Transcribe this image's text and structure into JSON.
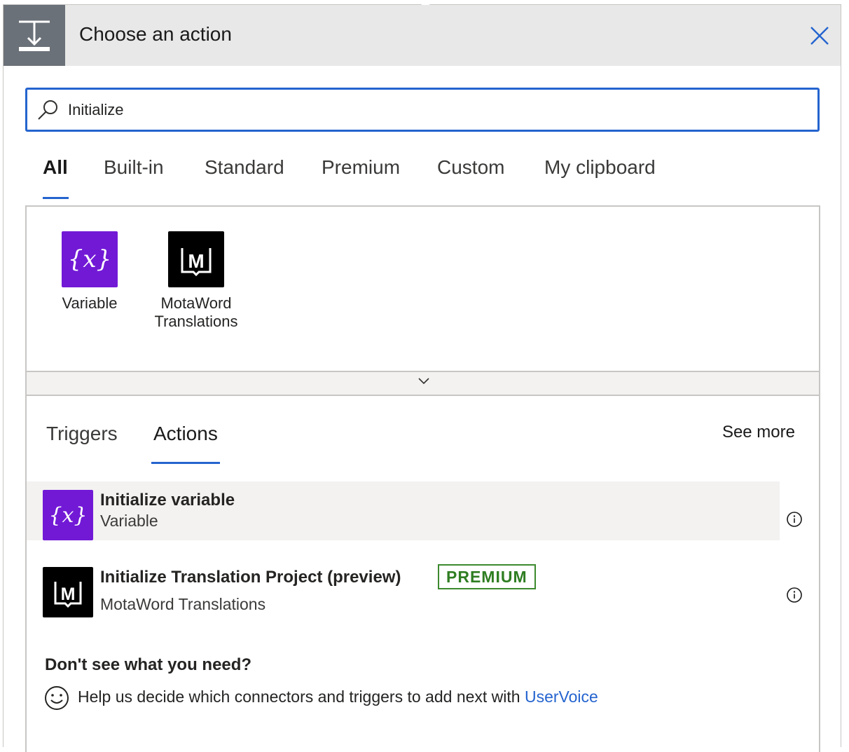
{
  "header": {
    "title": "Choose an action",
    "icon": "insert-step-icon",
    "close_icon": "close-icon"
  },
  "search": {
    "value": "Initialize",
    "icon": "search-icon"
  },
  "tabs": [
    {
      "label": "All",
      "active": true
    },
    {
      "label": "Built-in"
    },
    {
      "label": "Standard"
    },
    {
      "label": "Premium"
    },
    {
      "label": "Custom"
    },
    {
      "label": "My clipboard"
    }
  ],
  "connectors": [
    {
      "label": "Variable",
      "icon": "variable-icon",
      "color": "#7219d6"
    },
    {
      "label_line1": "MotaWord",
      "label_line2": "Translations",
      "icon": "motaword-icon",
      "color": "#000000"
    }
  ],
  "expand_icon": "chevron-down-icon",
  "sub_tabs": [
    {
      "label": "Triggers"
    },
    {
      "label": "Actions",
      "active": true
    }
  ],
  "see_more": "See more",
  "actions": [
    {
      "title": "Initialize variable",
      "subtitle": "Variable",
      "icon": "variable-icon",
      "info_icon": "info-icon"
    },
    {
      "title": "Initialize Translation Project (preview)",
      "subtitle": "MotaWord Translations",
      "badge": "PREMIUM",
      "icon": "motaword-icon",
      "info_icon": "info-icon"
    }
  ],
  "footer": {
    "heading": "Don't see what you need?",
    "help_text": "Help us decide which connectors and triggers to add next with ",
    "link": "UserVoice",
    "icon": "smiley-icon"
  },
  "colors": {
    "accent": "#2564cf",
    "premium": "#3c8a2e",
    "variable": "#7219d6"
  }
}
